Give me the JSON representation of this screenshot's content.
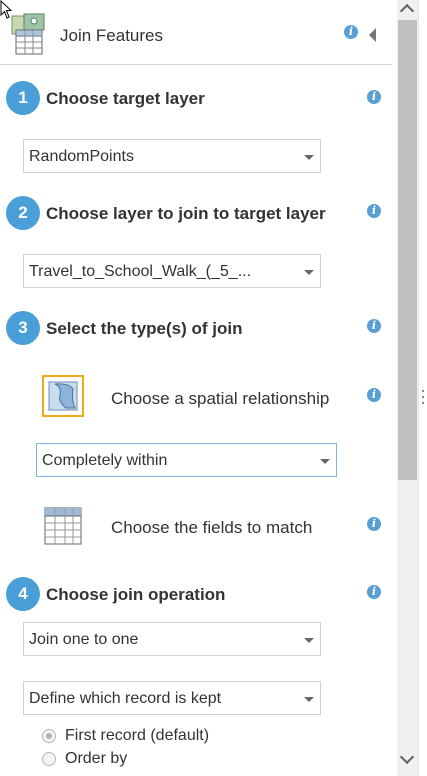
{
  "header": {
    "title": "Join Features"
  },
  "steps": [
    {
      "number": "1",
      "title": "Choose target layer"
    },
    {
      "number": "2",
      "title": "Choose layer to join to target layer"
    },
    {
      "number": "3",
      "title": "Select the type(s) of join"
    },
    {
      "number": "4",
      "title": "Choose join operation"
    }
  ],
  "target_layer": {
    "value": "RandomPoints"
  },
  "join_layer": {
    "value": "Travel_to_School_Walk_(_5_..."
  },
  "join_types": {
    "spatial_label": "Choose a spatial relationship",
    "spatial_value": "Completely within",
    "fields_label": "Choose the fields to match"
  },
  "join_operation": {
    "value": "Join one to one",
    "record_kept_value": "Define which record is kept",
    "radio_options": [
      {
        "label": "First record (default)",
        "checked": true
      },
      {
        "label": "Order by",
        "checked": false
      }
    ]
  },
  "colors": {
    "accent": "#4a9fd8",
    "info": "#5a9fd4",
    "spatial_icon_border": "#f0a81c"
  }
}
